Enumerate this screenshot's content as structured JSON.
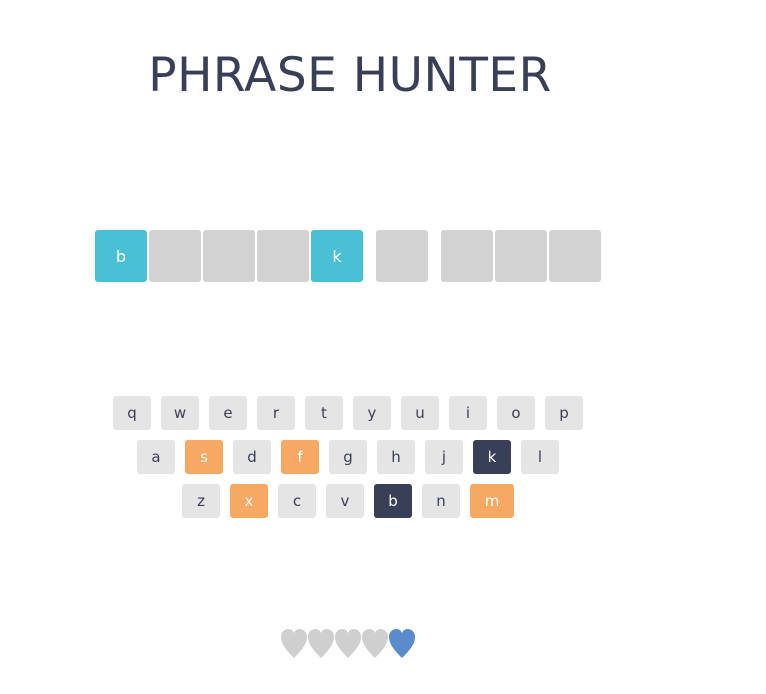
{
  "title": "PHRASE HUNTER",
  "phrase": {
    "words": [
      [
        {
          "letter": "b",
          "shown": true
        },
        {
          "letter": "",
          "shown": false
        },
        {
          "letter": "",
          "shown": false
        },
        {
          "letter": "",
          "shown": false
        },
        {
          "letter": "k",
          "shown": true
        }
      ],
      [
        {
          "letter": "",
          "shown": false
        }
      ],
      [
        {
          "letter": "",
          "shown": false
        },
        {
          "letter": "",
          "shown": false
        },
        {
          "letter": "",
          "shown": false
        }
      ]
    ]
  },
  "keyboard": {
    "rows": [
      [
        {
          "key": "q",
          "state": "unused"
        },
        {
          "key": "w",
          "state": "unused"
        },
        {
          "key": "e",
          "state": "unused"
        },
        {
          "key": "r",
          "state": "unused"
        },
        {
          "key": "t",
          "state": "unused"
        },
        {
          "key": "y",
          "state": "unused"
        },
        {
          "key": "u",
          "state": "unused"
        },
        {
          "key": "i",
          "state": "unused"
        },
        {
          "key": "o",
          "state": "unused"
        },
        {
          "key": "p",
          "state": "unused"
        }
      ],
      [
        {
          "key": "a",
          "state": "unused"
        },
        {
          "key": "s",
          "state": "wrong"
        },
        {
          "key": "d",
          "state": "unused"
        },
        {
          "key": "f",
          "state": "wrong"
        },
        {
          "key": "g",
          "state": "unused"
        },
        {
          "key": "h",
          "state": "unused"
        },
        {
          "key": "j",
          "state": "unused"
        },
        {
          "key": "k",
          "state": "chosen"
        },
        {
          "key": "l",
          "state": "unused"
        }
      ],
      [
        {
          "key": "z",
          "state": "unused"
        },
        {
          "key": "x",
          "state": "wrong"
        },
        {
          "key": "c",
          "state": "unused"
        },
        {
          "key": "v",
          "state": "unused"
        },
        {
          "key": "b",
          "state": "chosen"
        },
        {
          "key": "n",
          "state": "unused"
        },
        {
          "key": "m",
          "state": "wrong"
        }
      ]
    ]
  },
  "lives": {
    "total": 5,
    "remaining": 1,
    "lost_color": "#cfcfcf",
    "live_color": "#5a8ccb"
  },
  "colors": {
    "title": "#3a3f58",
    "revealed_tile": "#4ac0d6",
    "hidden_tile": "#d2d2d2",
    "key_default": "#e5e5e5",
    "key_wrong": "#f7a964",
    "key_chosen": "#3a3f58"
  }
}
